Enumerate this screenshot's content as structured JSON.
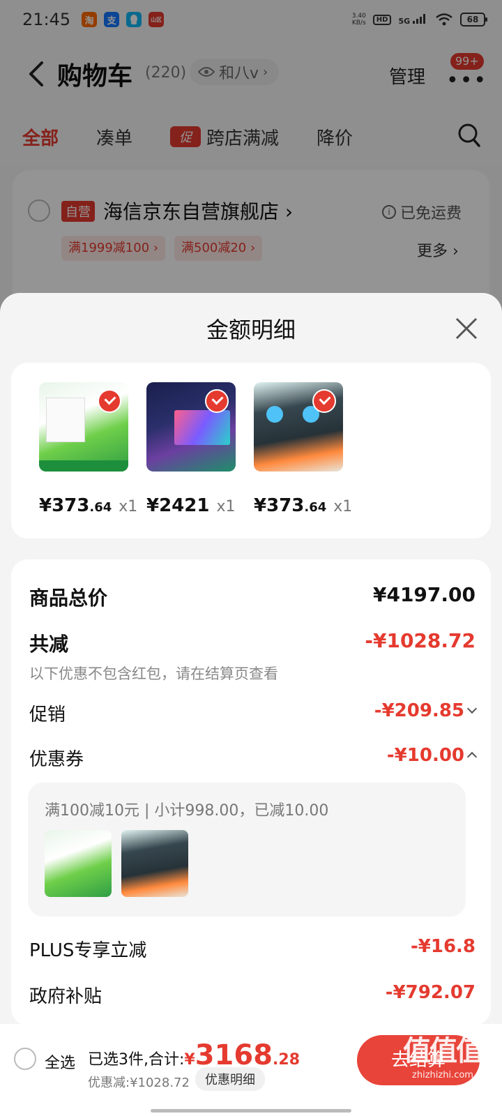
{
  "status": {
    "time": "21:45",
    "app_icons": [
      "淘",
      "支",
      "",
      "山区"
    ],
    "net_speed_value": "3.40",
    "net_speed_unit": "KB/s",
    "hd": "HD",
    "signal": "5G",
    "battery": "68"
  },
  "header": {
    "title": "购物车",
    "count": "(220)",
    "address": "和八v",
    "manage": "管理",
    "more_badge": "99+"
  },
  "tabs": [
    {
      "label": "全部",
      "active": true
    },
    {
      "label": "凑单"
    },
    {
      "label": "跨店满减",
      "tag": "促"
    },
    {
      "label": "降价"
    }
  ],
  "store": {
    "tag": "自营",
    "name": "海信京东自营旗舰店",
    "shipping": "已免运费",
    "coupons": [
      "满1999减100",
      "满500减20"
    ],
    "more": "更多"
  },
  "sheet": {
    "title": "金额明细",
    "products": [
      {
        "price_int": "¥373",
        "price_dec": ".64",
        "qty": "x1"
      },
      {
        "price_int": "¥2421",
        "price_dec": "",
        "qty": "x1"
      },
      {
        "price_int": "¥373",
        "price_dec": ".64",
        "qty": "x1"
      }
    ],
    "details": {
      "subtotal_label": "商品总价",
      "subtotal_value": "¥4197.00",
      "reduce_label": "共减",
      "reduce_value": "-¥1028.72",
      "reduce_note": "以下优惠不包含红包，请在结算页查看",
      "promo_label": "促销",
      "promo_value": "-¥209.85",
      "coupon_label": "优惠券",
      "coupon_value": "-¥10.00",
      "coupon_detail": "满100减10元 | 小计998.00，已减10.00",
      "plus_label": "PLUS专享立减",
      "plus_value": "-¥16.8",
      "gov_label": "政府补贴",
      "gov_value": "-¥792.07"
    }
  },
  "bottom": {
    "select_all": "全选",
    "selected_prefix": "已选3件,合计:",
    "currency": "¥",
    "total_int": "3168",
    "total_dec": ".28",
    "discount_line": "优惠减:¥1028.72",
    "detail_button": "优惠明细",
    "checkout": "去结算",
    "watermark": "值值值",
    "watermark_url": "zhizhizhi.com"
  },
  "colors": {
    "accent": "#e53a2f",
    "sheet_bg": "#f4f4f4"
  }
}
